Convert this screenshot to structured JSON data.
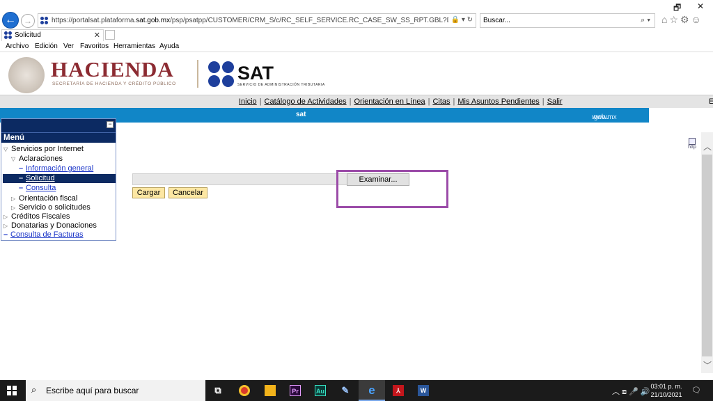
{
  "browser": {
    "window_controls": {
      "restore": "🗗",
      "close": "✕"
    },
    "url_prefix": "https://portalsat.plataforma.",
    "url_domain": "sat.gob.mx",
    "url_rest": "/psp/psatpp/CUSTOMER/CRM_S/c/RC_SELF_SERVICE.RC_CASE_SW_SS_RPT.GBL?DISP_TMPL_ID=RC_SUPI",
    "url_icons": "🔒 ▾ ↻",
    "search_placeholder": "Buscar...",
    "search_icon": "⌕ ▾",
    "tool_icons": "⌂☆⚙☺",
    "tab_title": "Solicitud",
    "tab_close": "✕",
    "menu": [
      "Archivo",
      "Edición",
      "Ver",
      "Favoritos",
      "Herramientas",
      "Ayuda"
    ]
  },
  "header": {
    "hacienda": "HACIENDA",
    "hacienda_sub": "SECRETARÍA DE HACIENDA Y CRÉDITO PÚBLICO",
    "sat": "SAT",
    "sat_sub": "SERVICIO DE ADMINISTRACIÓN TRIBUTARIA"
  },
  "topnav": {
    "links": [
      "Inicio",
      "Catálogo de Actividades",
      "Orientación en Línea",
      "Citas",
      "Mis Asuntos Pendientes",
      "Salir"
    ],
    "edge": "E"
  },
  "band": {
    "prefix": "www.",
    "bold": "sat",
    "suffix": ".gob.mx"
  },
  "side_menu": {
    "title": "Menú",
    "minimize": "−",
    "items": [
      {
        "label": "Servicios por Internet",
        "type": "open"
      },
      {
        "label": "Aclaraciones",
        "type": "open"
      },
      {
        "label": "Información general",
        "type": "link"
      },
      {
        "label": "Solicitud",
        "type": "selected"
      },
      {
        "label": "Consulta",
        "type": "link"
      },
      {
        "label": "Orientación fiscal",
        "type": "closed"
      },
      {
        "label": "Servicio o solicitudes",
        "type": "closed"
      },
      {
        "label": "Créditos Fiscales",
        "type": "closed"
      },
      {
        "label": "Donatarias y Donaciones",
        "type": "closed"
      },
      {
        "label": "Consulta de Facturas",
        "type": "link"
      }
    ]
  },
  "form": {
    "file_value": "",
    "browse_label": "Examinar...",
    "upload_label": "Cargar",
    "cancel_label": "Cancelar"
  },
  "side_icon_label": "http",
  "scroll": {
    "up": "︿",
    "down": "﹀"
  },
  "taskbar": {
    "search_icon": "⌕",
    "search_placeholder": "Escribe aquí para buscar",
    "apps": [
      {
        "name": "task-view",
        "glyph": "⧉",
        "color": "#1b1b1b"
      },
      {
        "name": "chrome",
        "glyph": "●",
        "color": "#d93a2b"
      },
      {
        "name": "file-explorer",
        "glyph": "▬",
        "color": "#f2b31b"
      },
      {
        "name": "premiere",
        "glyph": "Pr",
        "color": "#2a0a3a"
      },
      {
        "name": "audition",
        "glyph": "Au",
        "color": "#0b3b37"
      },
      {
        "name": "paint",
        "glyph": "✎",
        "color": "#4a6fa5"
      },
      {
        "name": "internet-explorer",
        "glyph": "e",
        "color": "#1e78d4"
      },
      {
        "name": "acrobat",
        "glyph": "⅄",
        "color": "#c4161c"
      },
      {
        "name": "word",
        "glyph": "W",
        "color": "#2b579a"
      }
    ],
    "tray_icons": "︿ ⧈ 🎤 🔊",
    "time": "03:01 p. m.",
    "date": "21/10/2021",
    "notif": "🗨"
  }
}
